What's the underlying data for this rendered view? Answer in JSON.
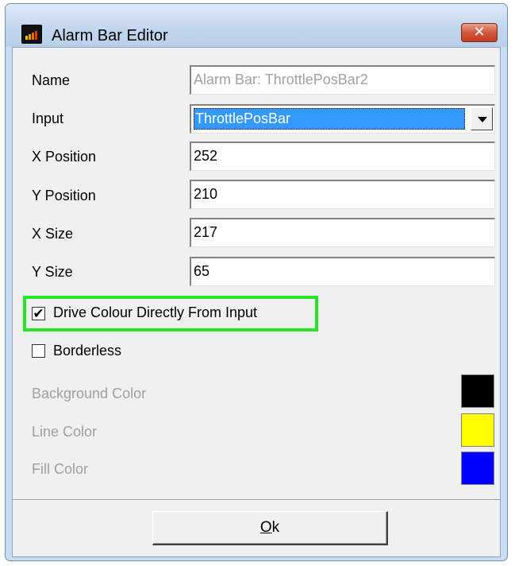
{
  "window": {
    "title": "Alarm Bar Editor",
    "close_glyph": "✕",
    "app_icon": "bar-chart-icon"
  },
  "fields": {
    "name": {
      "label": "Name",
      "value": "Alarm Bar: ThrottlePosBar2"
    },
    "input": {
      "label": "Input",
      "value": "ThrottlePosBar"
    },
    "x_position": {
      "label": "X Position",
      "value": "252"
    },
    "y_position": {
      "label": "Y Position",
      "value": "210"
    },
    "x_size": {
      "label": "X Size",
      "value": "217"
    },
    "y_size": {
      "label": "Y Size",
      "value": "65"
    }
  },
  "options": {
    "drive_colour": {
      "label": "Drive Colour Directly From Input",
      "checked": true,
      "mark": "✔"
    },
    "borderless": {
      "label": "Borderless",
      "checked": false
    }
  },
  "colors": {
    "background": {
      "label": "Background Color",
      "value": "#000000"
    },
    "line": {
      "label": "Line Color",
      "value": "#ffff00"
    },
    "fill": {
      "label": "Fill Color",
      "value": "#0000ff"
    }
  },
  "footer": {
    "ok_mnemonic": "O",
    "ok_rest": "k"
  }
}
